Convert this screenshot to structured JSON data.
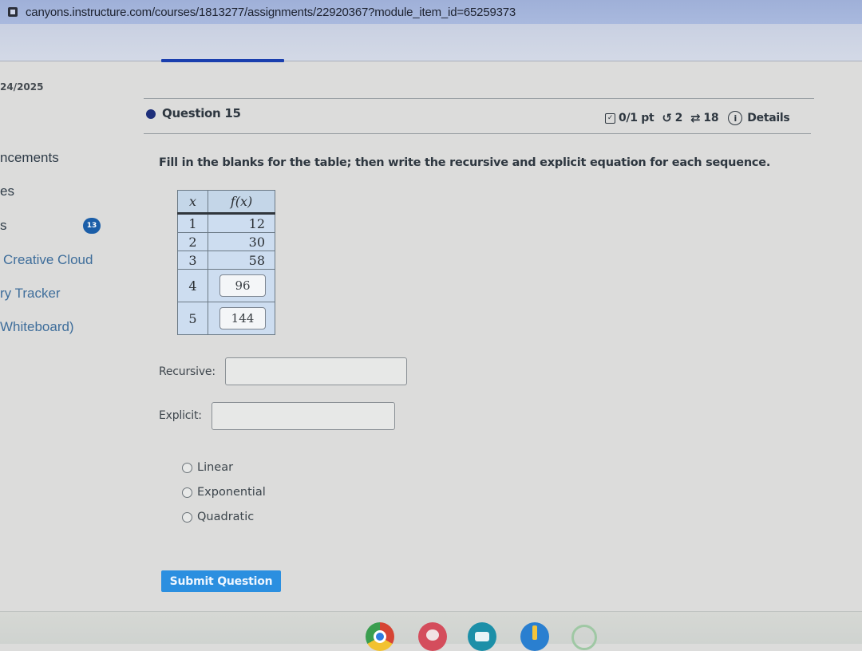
{
  "browser": {
    "url": "canyons.instructure.com/courses/1813277/assignments/22920367?module_item_id=65259373"
  },
  "page": {
    "date": "24/2025"
  },
  "sidebar": {
    "items": [
      {
        "label": "ncements"
      },
      {
        "label": "es"
      },
      {
        "label": "s"
      },
      {
        "label": "Creative Cloud"
      },
      {
        "label": "ry Tracker"
      },
      {
        "label": "Whiteboard)"
      }
    ],
    "badge": "13"
  },
  "question": {
    "title": "Question 15",
    "score": "0/1 pt",
    "retries": "2",
    "attempts": "18",
    "details_label": "Details",
    "instruction": "Fill in the blanks for the table; then write the recursive and explicit equation for each sequence.",
    "table": {
      "headers": [
        "x",
        "f(x)"
      ],
      "rows": [
        {
          "x": "1",
          "fx": "12",
          "editable": false
        },
        {
          "x": "2",
          "fx": "30",
          "editable": false
        },
        {
          "x": "3",
          "fx": "58",
          "editable": false
        },
        {
          "x": "4",
          "fx": "96",
          "editable": true
        },
        {
          "x": "5",
          "fx": "144",
          "editable": true
        }
      ]
    },
    "recursive_label": "Recursive:",
    "recursive_value": "",
    "explicit_label": "Explicit:",
    "explicit_value": "",
    "options": [
      "Linear",
      "Exponential",
      "Quadratic"
    ],
    "submit_label": "Submit Question"
  },
  "taskbar": {
    "apps": [
      "chrome-icon",
      "canvas-paint-icon",
      "screencast-icon",
      "pencil-app-icon",
      "loading-app-icon"
    ]
  }
}
